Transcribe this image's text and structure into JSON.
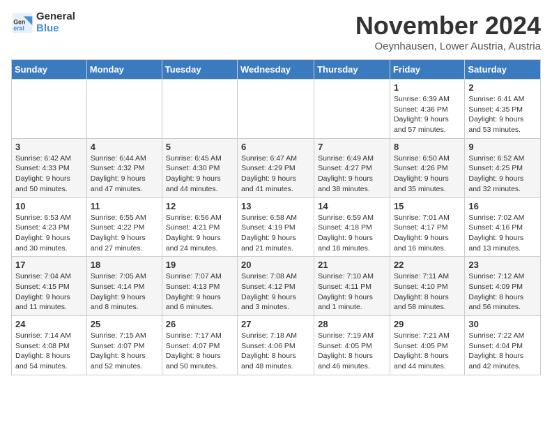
{
  "header": {
    "logo_line1": "General",
    "logo_line2": "Blue",
    "month": "November 2024",
    "location": "Oeynhausen, Lower Austria, Austria"
  },
  "weekdays": [
    "Sunday",
    "Monday",
    "Tuesday",
    "Wednesday",
    "Thursday",
    "Friday",
    "Saturday"
  ],
  "weeks": [
    [
      {
        "day": "",
        "info": ""
      },
      {
        "day": "",
        "info": ""
      },
      {
        "day": "",
        "info": ""
      },
      {
        "day": "",
        "info": ""
      },
      {
        "day": "",
        "info": ""
      },
      {
        "day": "1",
        "info": "Sunrise: 6:39 AM\nSunset: 4:36 PM\nDaylight: 9 hours\nand 57 minutes."
      },
      {
        "day": "2",
        "info": "Sunrise: 6:41 AM\nSunset: 4:35 PM\nDaylight: 9 hours\nand 53 minutes."
      }
    ],
    [
      {
        "day": "3",
        "info": "Sunrise: 6:42 AM\nSunset: 4:33 PM\nDaylight: 9 hours\nand 50 minutes."
      },
      {
        "day": "4",
        "info": "Sunrise: 6:44 AM\nSunset: 4:32 PM\nDaylight: 9 hours\nand 47 minutes."
      },
      {
        "day": "5",
        "info": "Sunrise: 6:45 AM\nSunset: 4:30 PM\nDaylight: 9 hours\nand 44 minutes."
      },
      {
        "day": "6",
        "info": "Sunrise: 6:47 AM\nSunset: 4:29 PM\nDaylight: 9 hours\nand 41 minutes."
      },
      {
        "day": "7",
        "info": "Sunrise: 6:49 AM\nSunset: 4:27 PM\nDaylight: 9 hours\nand 38 minutes."
      },
      {
        "day": "8",
        "info": "Sunrise: 6:50 AM\nSunset: 4:26 PM\nDaylight: 9 hours\nand 35 minutes."
      },
      {
        "day": "9",
        "info": "Sunrise: 6:52 AM\nSunset: 4:25 PM\nDaylight: 9 hours\nand 32 minutes."
      }
    ],
    [
      {
        "day": "10",
        "info": "Sunrise: 6:53 AM\nSunset: 4:23 PM\nDaylight: 9 hours\nand 30 minutes."
      },
      {
        "day": "11",
        "info": "Sunrise: 6:55 AM\nSunset: 4:22 PM\nDaylight: 9 hours\nand 27 minutes."
      },
      {
        "day": "12",
        "info": "Sunrise: 6:56 AM\nSunset: 4:21 PM\nDaylight: 9 hours\nand 24 minutes."
      },
      {
        "day": "13",
        "info": "Sunrise: 6:58 AM\nSunset: 4:19 PM\nDaylight: 9 hours\nand 21 minutes."
      },
      {
        "day": "14",
        "info": "Sunrise: 6:59 AM\nSunset: 4:18 PM\nDaylight: 9 hours\nand 18 minutes."
      },
      {
        "day": "15",
        "info": "Sunrise: 7:01 AM\nSunset: 4:17 PM\nDaylight: 9 hours\nand 16 minutes."
      },
      {
        "day": "16",
        "info": "Sunrise: 7:02 AM\nSunset: 4:16 PM\nDaylight: 9 hours\nand 13 minutes."
      }
    ],
    [
      {
        "day": "17",
        "info": "Sunrise: 7:04 AM\nSunset: 4:15 PM\nDaylight: 9 hours\nand 11 minutes."
      },
      {
        "day": "18",
        "info": "Sunrise: 7:05 AM\nSunset: 4:14 PM\nDaylight: 9 hours\nand 8 minutes."
      },
      {
        "day": "19",
        "info": "Sunrise: 7:07 AM\nSunset: 4:13 PM\nDaylight: 9 hours\nand 6 minutes."
      },
      {
        "day": "20",
        "info": "Sunrise: 7:08 AM\nSunset: 4:12 PM\nDaylight: 9 hours\nand 3 minutes."
      },
      {
        "day": "21",
        "info": "Sunrise: 7:10 AM\nSunset: 4:11 PM\nDaylight: 9 hours\nand 1 minute."
      },
      {
        "day": "22",
        "info": "Sunrise: 7:11 AM\nSunset: 4:10 PM\nDaylight: 8 hours\nand 58 minutes."
      },
      {
        "day": "23",
        "info": "Sunrise: 7:12 AM\nSunset: 4:09 PM\nDaylight: 8 hours\nand 56 minutes."
      }
    ],
    [
      {
        "day": "24",
        "info": "Sunrise: 7:14 AM\nSunset: 4:08 PM\nDaylight: 8 hours\nand 54 minutes."
      },
      {
        "day": "25",
        "info": "Sunrise: 7:15 AM\nSunset: 4:07 PM\nDaylight: 8 hours\nand 52 minutes."
      },
      {
        "day": "26",
        "info": "Sunrise: 7:17 AM\nSunset: 4:07 PM\nDaylight: 8 hours\nand 50 minutes."
      },
      {
        "day": "27",
        "info": "Sunrise: 7:18 AM\nSunset: 4:06 PM\nDaylight: 8 hours\nand 48 minutes."
      },
      {
        "day": "28",
        "info": "Sunrise: 7:19 AM\nSunset: 4:05 PM\nDaylight: 8 hours\nand 46 minutes."
      },
      {
        "day": "29",
        "info": "Sunrise: 7:21 AM\nSunset: 4:05 PM\nDaylight: 8 hours\nand 44 minutes."
      },
      {
        "day": "30",
        "info": "Sunrise: 7:22 AM\nSunset: 4:04 PM\nDaylight: 8 hours\nand 42 minutes."
      }
    ]
  ]
}
